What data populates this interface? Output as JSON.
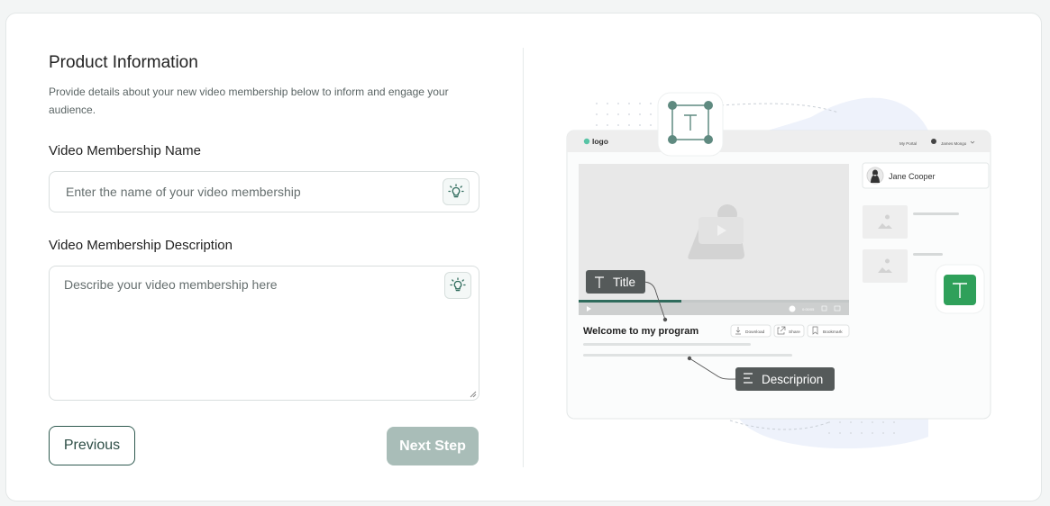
{
  "form": {
    "title": "Product Information",
    "description": "Provide details about your new video membership below to inform and engage your audience.",
    "name_label": "Video Membership Name",
    "name_placeholder": "Enter the name of your video membership",
    "description_label": "Video Membership Description",
    "description_placeholder": "Describe your video membership here",
    "bulb_icon": "lightbulb-icon"
  },
  "buttons": {
    "previous": "Previous",
    "next": "Next Step"
  },
  "illustration": {
    "logo": "logo",
    "nav_portal": "My Portal",
    "nav_user": "James Mongo",
    "profile_name": "Jane Cooper",
    "video_heading": "Welcome to my program",
    "download": "Download",
    "share": "Share",
    "bookmark": "Bookmark",
    "title_tag": "Title",
    "description_tag": "Descriprion",
    "player_time": "0:00/05"
  },
  "colors": {
    "accent": "#2f5a50",
    "brand_green": "#2fa05a",
    "disabled_button": "#a9bdb8",
    "tag_bg": "#555a5a"
  }
}
